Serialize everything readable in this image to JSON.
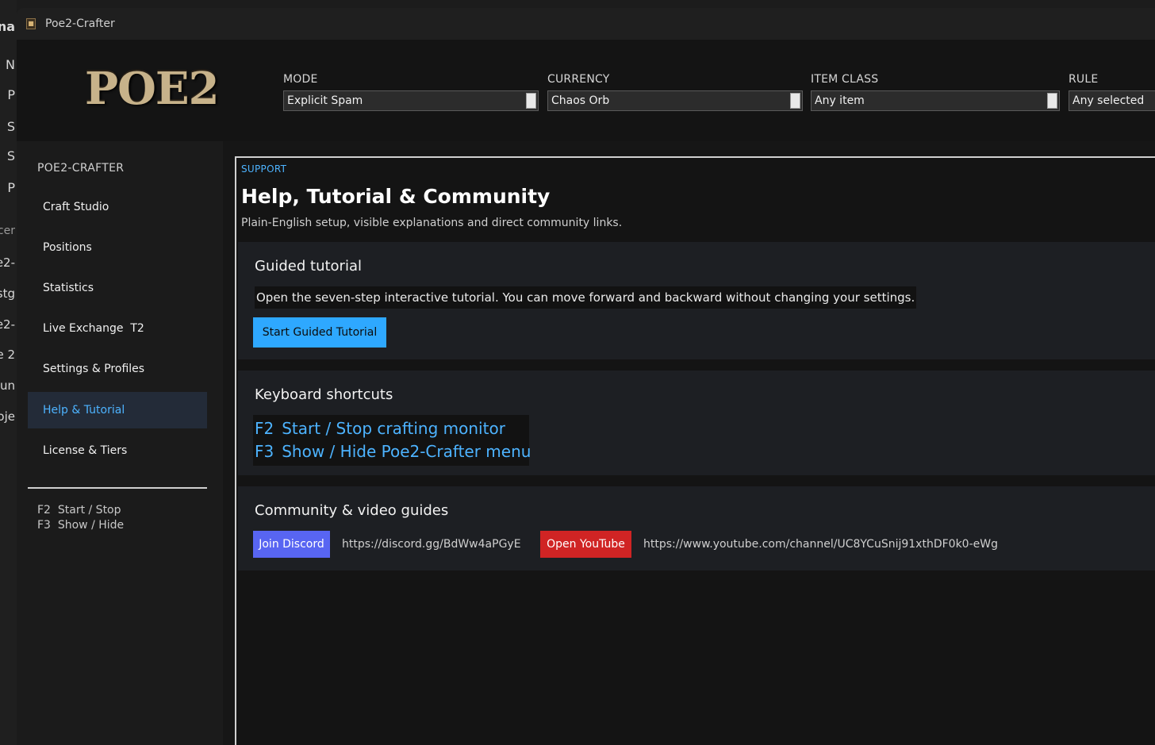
{
  "background_window": {
    "fragments": [
      "na",
      "N",
      "P",
      "S",
      "S",
      "P",
      "cer",
      "e2-",
      "stg",
      "e2-",
      "e 2",
      "un",
      "oje"
    ]
  },
  "window": {
    "title": "Poe2-Crafter"
  },
  "header": {
    "logo_text": "POE2",
    "fields": [
      {
        "label": "MODE",
        "value": "Explicit Spam"
      },
      {
        "label": "CURRENCY",
        "value": "Chaos Orb"
      },
      {
        "label": "ITEM CLASS",
        "value": "Any item"
      },
      {
        "label": "RULE",
        "value": "Any selected"
      }
    ]
  },
  "sidebar": {
    "brand": "POE2-CRAFTER",
    "items": [
      {
        "label": "Craft Studio"
      },
      {
        "label": "Positions"
      },
      {
        "label": "Statistics"
      },
      {
        "label": "Live Exchange  T2"
      },
      {
        "label": "Settings & Profiles"
      },
      {
        "label": "Help & Tutorial",
        "active": true
      },
      {
        "label": "License & Tiers"
      }
    ],
    "shortcuts": [
      "F2  Start / Stop",
      "F3  Show / Hide"
    ]
  },
  "main": {
    "eyebrow": "SUPPORT",
    "title": "Help, Tutorial & Community",
    "subtitle": "Plain-English setup, visible explanations and direct community links.",
    "tutorial": {
      "title": "Guided tutorial",
      "text": "Open the seven-step interactive tutorial. You can move forward and backward without changing your settings.",
      "button": "Start Guided Tutorial"
    },
    "shortcuts": {
      "title": "Keyboard shortcuts",
      "rows": [
        {
          "key": "F2",
          "action": "Start / Stop crafting monitor"
        },
        {
          "key": "F3",
          "action": "Show / Hide Poe2-Crafter menu"
        }
      ]
    },
    "community": {
      "title": "Community & video guides",
      "discord_button": "Join Discord",
      "discord_url": "https://discord.gg/BdWw4aPGyE",
      "youtube_button": "Open YouTube",
      "youtube_url": "https://www.youtube.com/channel/UC8YCuSnij91xthDF0k0-eWg"
    }
  },
  "colors": {
    "accent": "#4db3ff",
    "primary_button": "#2ea8ff",
    "discord": "#5865f2",
    "youtube": "#d02424"
  }
}
